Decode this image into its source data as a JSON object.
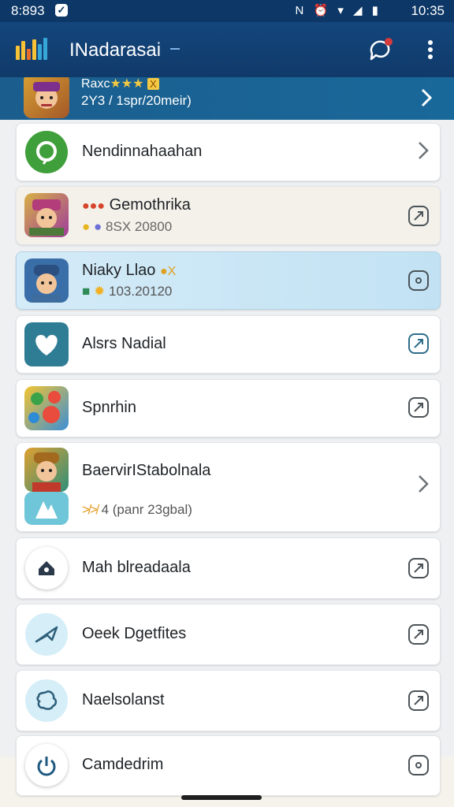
{
  "status_bar": {
    "time": "8:893",
    "clock": "10:35",
    "icons": "N ⏰ ▾ ◢ ▮"
  },
  "app_bar": {
    "title": "INadarasai"
  },
  "banner": {
    "line1_text": "Raxc",
    "line1_stars": "★★★",
    "line1_badge": "X",
    "line2": "2Y3 / 1spr/20meir)"
  },
  "rows": [
    {
      "label": "Nendinnahaahan",
      "sub": ""
    },
    {
      "label": "Gemothrika",
      "sub": "8SX 20800",
      "prefix": "●●●"
    },
    {
      "label": "Niaky Llao",
      "sub": "103.20120",
      "suffix": "●X"
    },
    {
      "label": "Alsrs Nadial",
      "sub": ""
    },
    {
      "label": "Spnrhin",
      "sub": ""
    },
    {
      "label": "BaervirIStabolnala",
      "sub": "4 (panr 23gbal)",
      "sub_prefix": "≯≯"
    },
    {
      "label": "Mah blreadaala",
      "sub": ""
    },
    {
      "label": "Oeek Dgetfites",
      "sub": ""
    },
    {
      "label": "Naelsolanst",
      "sub": ""
    },
    {
      "label": "Camdedrim",
      "sub": ""
    }
  ],
  "colors": {
    "app_bar": "#13467c",
    "banner": "#1b5e8e",
    "highlight_row": "#c8e5f5",
    "green_icon": "#3f9f3a"
  }
}
